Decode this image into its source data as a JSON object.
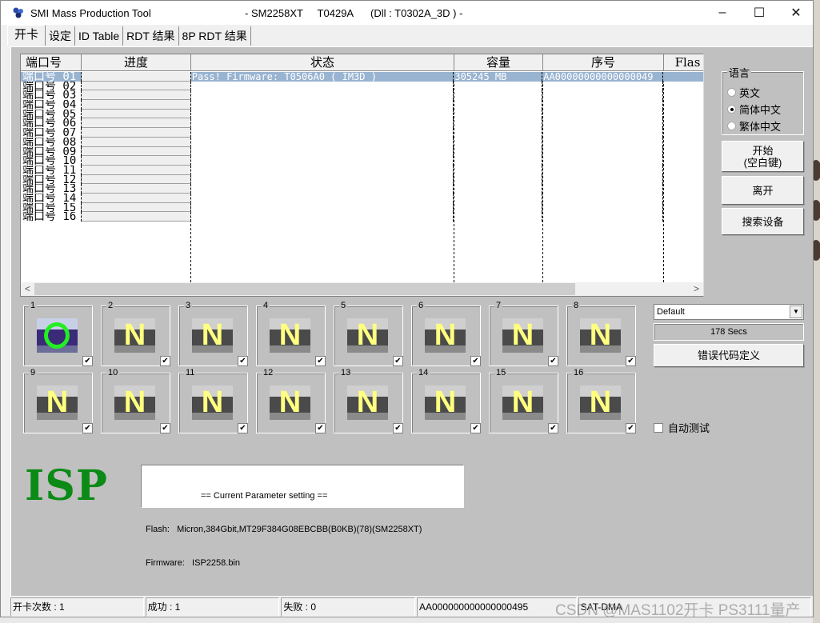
{
  "window": {
    "title": "SMI Mass Production Tool",
    "subtitle": "- SM2258XT     T0429A      (Dll : T0302A_3D ) -",
    "minimize_label": "–",
    "maximize_label": "☐",
    "close_label": "✕"
  },
  "tabs": [
    {
      "label": "开卡"
    },
    {
      "label": "设定"
    },
    {
      "label": "ID Table"
    },
    {
      "label": "RDT 结果"
    },
    {
      "label": "8P RDT 结果"
    }
  ],
  "list": {
    "columns": [
      "端口号",
      "进度",
      "状态",
      "容量",
      "序号",
      "Flas"
    ],
    "rows": [
      {
        "port": "端口号 01",
        "status": "Pass!  Firmware: T0506A0  (  IM3D )",
        "capacity": "305245 MB",
        "serial": "AA00000000000000049",
        "flash": "",
        "selected": true
      },
      {
        "port": "端口号 02",
        "status": "",
        "capacity": "",
        "serial": "",
        "flash": ""
      },
      {
        "port": "端口号 03",
        "status": "",
        "capacity": "",
        "serial": "",
        "flash": ""
      },
      {
        "port": "端口号 04",
        "status": "",
        "capacity": "",
        "serial": "",
        "flash": ""
      },
      {
        "port": "端口号 05",
        "status": "",
        "capacity": "",
        "serial": "",
        "flash": ""
      },
      {
        "port": "端口号 06",
        "status": "",
        "capacity": "",
        "serial": "",
        "flash": ""
      },
      {
        "port": "端口号 07",
        "status": "",
        "capacity": "",
        "serial": "",
        "flash": ""
      },
      {
        "port": "端口号 08",
        "status": "",
        "capacity": "",
        "serial": "",
        "flash": ""
      },
      {
        "port": "端口号 09",
        "status": "",
        "capacity": "",
        "serial": "",
        "flash": ""
      },
      {
        "port": "端口号 10",
        "status": "",
        "capacity": "",
        "serial": "",
        "flash": ""
      },
      {
        "port": "端口号 11",
        "status": "",
        "capacity": "",
        "serial": "",
        "flash": ""
      },
      {
        "port": "端口号 12",
        "status": "",
        "capacity": "",
        "serial": "",
        "flash": ""
      },
      {
        "port": "端口号 13",
        "status": "",
        "capacity": "",
        "serial": "",
        "flash": ""
      },
      {
        "port": "端口号 14",
        "status": "",
        "capacity": "",
        "serial": "",
        "flash": ""
      },
      {
        "port": "端口号 15",
        "status": "",
        "capacity": "",
        "serial": "",
        "flash": ""
      },
      {
        "port": "端口号 16",
        "status": "",
        "capacity": "",
        "serial": "",
        "flash": ""
      }
    ],
    "scroll_left": "<",
    "scroll_right": ">"
  },
  "language": {
    "legend": "语言",
    "options": [
      {
        "label": "英文",
        "selected": false
      },
      {
        "label": "简体中文",
        "selected": true
      },
      {
        "label": "繁体中文",
        "selected": false
      }
    ]
  },
  "buttons": {
    "start_line1": "开始",
    "start_line2": "(空白键)",
    "exit": "离开",
    "search": "搜索设备",
    "error_codes": "错误代码定义"
  },
  "slots": [
    {
      "label": "1",
      "glyph": "O",
      "state": "pass",
      "checked": true
    },
    {
      "label": "2",
      "glyph": "N",
      "state": "none",
      "checked": true
    },
    {
      "label": "3",
      "glyph": "N",
      "state": "none",
      "checked": true
    },
    {
      "label": "4",
      "glyph": "N",
      "state": "none",
      "checked": true
    },
    {
      "label": "5",
      "glyph": "N",
      "state": "none",
      "checked": true
    },
    {
      "label": "6",
      "glyph": "N",
      "state": "none",
      "checked": true
    },
    {
      "label": "7",
      "glyph": "N",
      "state": "none",
      "checked": true
    },
    {
      "label": "8",
      "glyph": "N",
      "state": "none",
      "checked": true
    },
    {
      "label": "9",
      "glyph": "N",
      "state": "none",
      "checked": true
    },
    {
      "label": "10",
      "glyph": "N",
      "state": "none",
      "checked": true
    },
    {
      "label": "11",
      "glyph": "N",
      "state": "none",
      "checked": true
    },
    {
      "label": "12",
      "glyph": "N",
      "state": "none",
      "checked": true
    },
    {
      "label": "13",
      "glyph": "N",
      "state": "none",
      "checked": true
    },
    {
      "label": "14",
      "glyph": "N",
      "state": "none",
      "checked": true
    },
    {
      "label": "15",
      "glyph": "N",
      "state": "none",
      "checked": true
    },
    {
      "label": "16",
      "glyph": "N",
      "state": "none",
      "checked": true
    }
  ],
  "check_mark": "✔",
  "profile": {
    "selected": "Default",
    "arrow": "▼"
  },
  "timer": "178 Secs",
  "auto_test": {
    "label": "自动测试",
    "checked": false
  },
  "mode_label": "ISP",
  "params": {
    "title": "== Current Parameter setting ==",
    "flash": "Flash:   Micron,384Gbit,MT29F384G08EBCBB(B0KB)(78)(SM2258XT)",
    "firmware": "Firmware:   ISP2258.bin"
  },
  "statusbar": {
    "count": "开卡次数 : 1",
    "success": "成功 : 1",
    "fail": "失败 : 0",
    "serial": "AA000000000000000495",
    "interface": "SAT-DMA"
  },
  "watermark": "CSDN @MAS1102开卡 PS3111量产"
}
